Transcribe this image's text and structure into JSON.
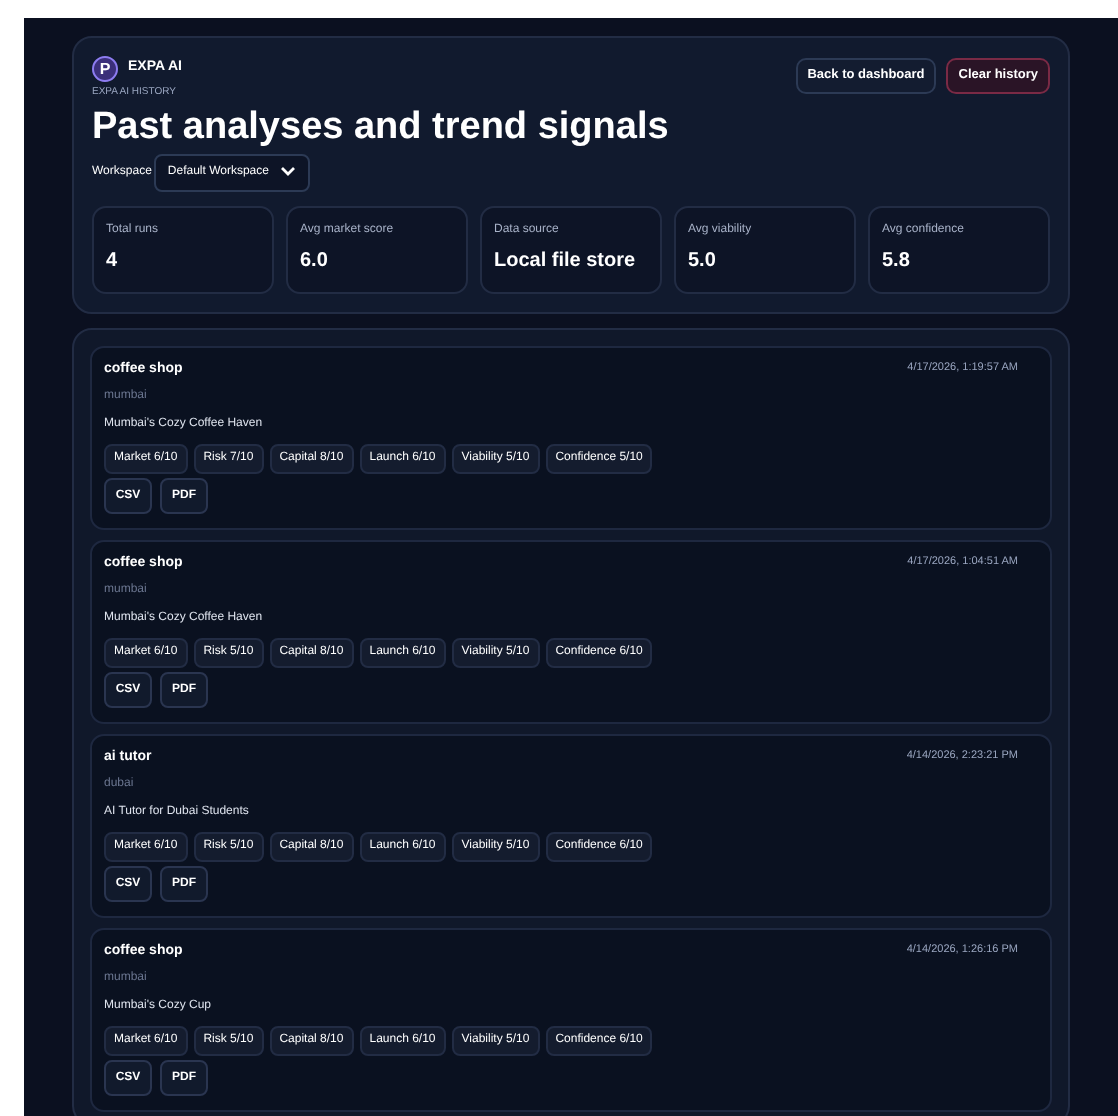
{
  "brand": {
    "name": "EXPA AI",
    "logo_letter": "P"
  },
  "eyebrow": "EXPA AI HISTORY",
  "title": "Past analyses and trend signals",
  "actions": [
    {
      "label": "Back to dashboard",
      "kind": "secondary"
    },
    {
      "label": "Clear history",
      "kind": "danger"
    }
  ],
  "workspace": {
    "label": "Workspace",
    "value": "Default Workspace"
  },
  "stats": [
    {
      "label": "Total runs",
      "value": "4"
    },
    {
      "label": "Avg market score",
      "value": "6.0"
    },
    {
      "label": "Data source",
      "value": "Local file store"
    },
    {
      "label": "Avg viability",
      "value": "5.0"
    },
    {
      "label": "Avg confidence",
      "value": "5.8"
    }
  ],
  "runs": [
    {
      "idea": "coffee shop",
      "city": "mumbai",
      "name": "Mumbai's Cozy Coffee Haven",
      "time": "4/17/2026, 1:19:57 AM",
      "scores": [
        "Market 6/10",
        "Risk 7/10",
        "Capital 8/10",
        "Launch 6/10",
        "Viability 5/10",
        "Confidence 5/10"
      ],
      "exports": [
        "CSV",
        "PDF"
      ]
    },
    {
      "idea": "coffee shop",
      "city": "mumbai",
      "name": "Mumbai's Cozy Coffee Haven",
      "time": "4/17/2026, 1:04:51 AM",
      "scores": [
        "Market 6/10",
        "Risk 5/10",
        "Capital 8/10",
        "Launch 6/10",
        "Viability 5/10",
        "Confidence 6/10"
      ],
      "exports": [
        "CSV",
        "PDF"
      ]
    },
    {
      "idea": "ai tutor",
      "city": "dubai",
      "name": "AI Tutor for Dubai Students",
      "time": "4/14/2026, 2:23:21 PM",
      "scores": [
        "Market 6/10",
        "Risk 5/10",
        "Capital 8/10",
        "Launch 6/10",
        "Viability 5/10",
        "Confidence 6/10"
      ],
      "exports": [
        "CSV",
        "PDF"
      ]
    },
    {
      "idea": "coffee shop",
      "city": "mumbai",
      "name": "Mumbai's Cozy Cup",
      "time": "4/14/2026, 1:26:16 PM",
      "scores": [
        "Market 6/10",
        "Risk 5/10",
        "Capital 8/10",
        "Launch 6/10",
        "Viability 5/10",
        "Confidence 6/10"
      ],
      "exports": [
        "CSV",
        "PDF"
      ]
    }
  ]
}
